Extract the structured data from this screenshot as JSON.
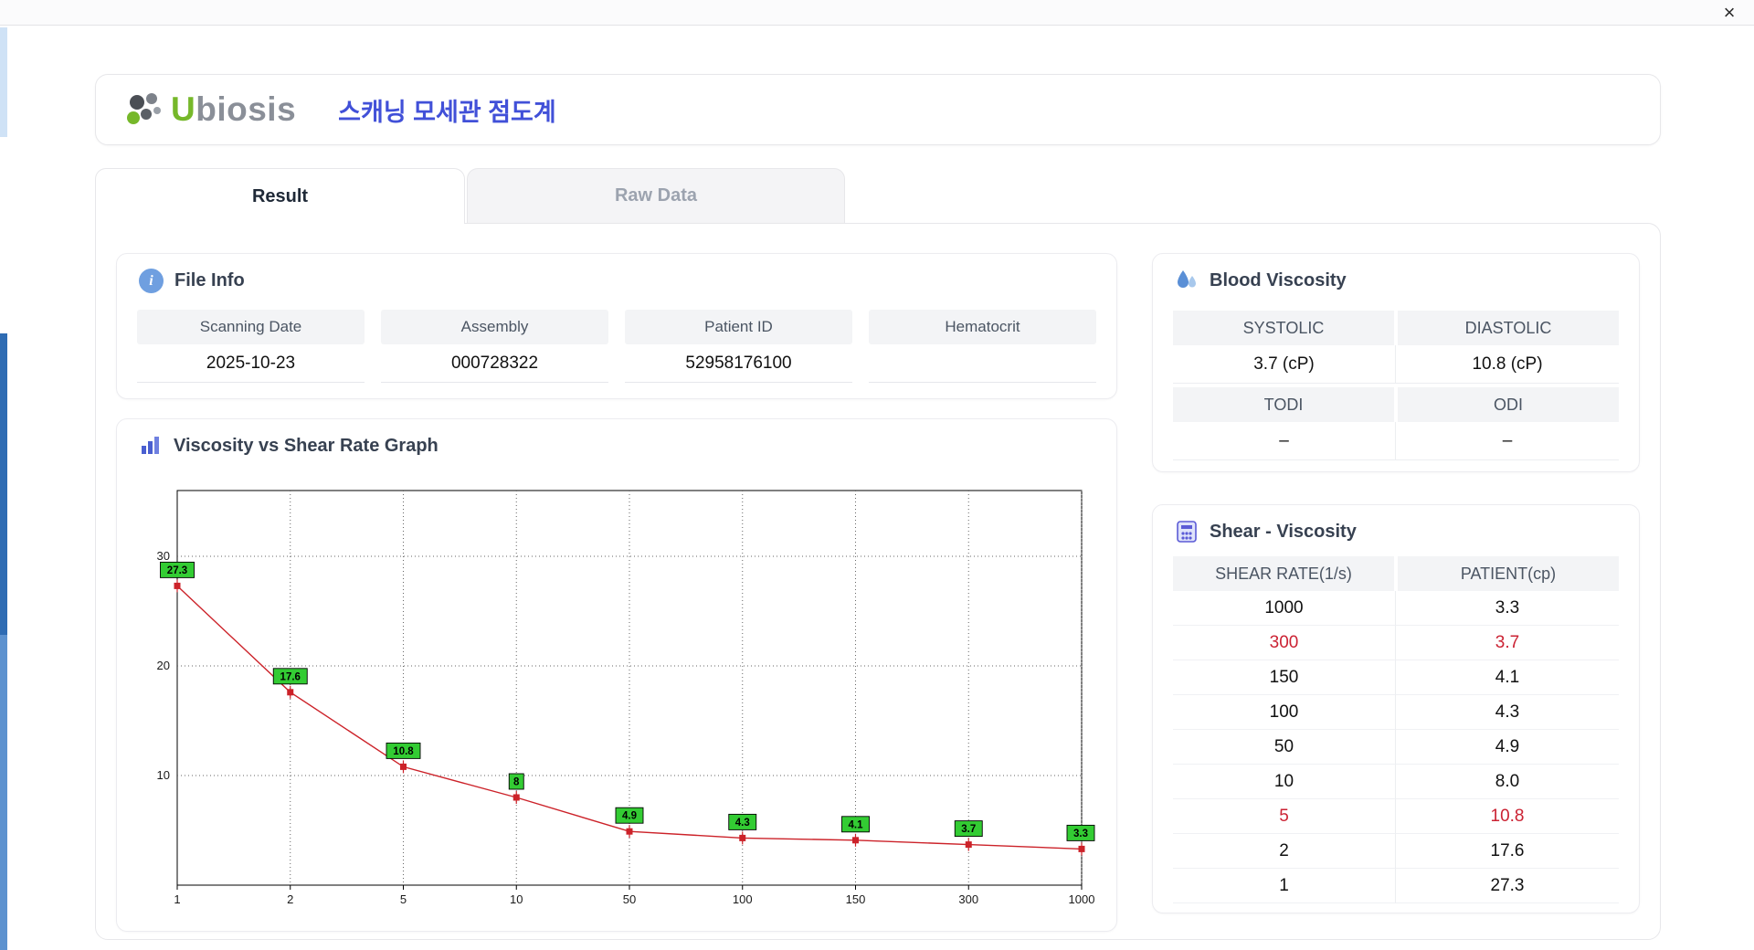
{
  "window": {
    "close_label": "×"
  },
  "colors": {
    "accent": "#4150d8",
    "highlight_red": "#cb2233",
    "logo_green": "#76b82a",
    "line_red": "#cc2229",
    "label_green": "#33cc33"
  },
  "header": {
    "brand_u": "U",
    "brand_rest": "biosis",
    "title": "스캐닝 모세관 점도계"
  },
  "tabs": [
    {
      "label": "Result",
      "active": true
    },
    {
      "label": "Raw Data",
      "active": false
    }
  ],
  "file_info": {
    "title": "File Info",
    "icon": "info-icon",
    "fields": [
      {
        "label": "Scanning Date",
        "value": "2025-10-23"
      },
      {
        "label": "Assembly",
        "value": "000728322"
      },
      {
        "label": "Patient ID",
        "value": "52958176100"
      },
      {
        "label": "Hematocrit",
        "value": ""
      }
    ]
  },
  "chart_data": {
    "type": "line",
    "title": "Viscosity vs Shear Rate Graph",
    "icon": "bar-chart-icon",
    "x": [
      1,
      2,
      5,
      10,
      50,
      100,
      150,
      300,
      1000
    ],
    "values": [
      27.3,
      17.6,
      10.8,
      8,
      4.9,
      4.3,
      4.1,
      3.7,
      3.3
    ],
    "labels": [
      "27.3",
      "17.6",
      "10.8",
      "8",
      "4.9",
      "4.3",
      "4.1",
      "3.7",
      "3.3"
    ],
    "xlabel": "",
    "ylabel": "",
    "ylim": [
      0,
      36
    ],
    "yticks": [
      10,
      20,
      30
    ],
    "x_scale": "categorical",
    "grid": "dotted",
    "line_color": "#cc2229",
    "marker_color": "#cc2229",
    "label_bg": "#33cc33"
  },
  "blood_viscosity": {
    "title": "Blood Viscosity",
    "icon": "droplet-icon",
    "rows": [
      {
        "headers": [
          "SYSTOLIC",
          "DIASTOLIC"
        ],
        "values": [
          "3.7 (cP)",
          "10.8 (cP)"
        ]
      },
      {
        "headers": [
          "TODI",
          "ODI"
        ],
        "values": [
          "–",
          "–"
        ]
      }
    ]
  },
  "shear_viscosity": {
    "title": "Shear - Viscosity",
    "icon": "calculator-icon",
    "columns": [
      "SHEAR RATE(1/s)",
      "PATIENT(cp)"
    ],
    "rows": [
      {
        "rate": "1000",
        "value": "3.3",
        "highlight": false
      },
      {
        "rate": "300",
        "value": "3.7",
        "highlight": true
      },
      {
        "rate": "150",
        "value": "4.1",
        "highlight": false
      },
      {
        "rate": "100",
        "value": "4.3",
        "highlight": false
      },
      {
        "rate": "50",
        "value": "4.9",
        "highlight": false
      },
      {
        "rate": "10",
        "value": "8.0",
        "highlight": false
      },
      {
        "rate": "5",
        "value": "10.8",
        "highlight": true
      },
      {
        "rate": "2",
        "value": "17.6",
        "highlight": false
      },
      {
        "rate": "1",
        "value": "27.3",
        "highlight": false
      }
    ]
  }
}
